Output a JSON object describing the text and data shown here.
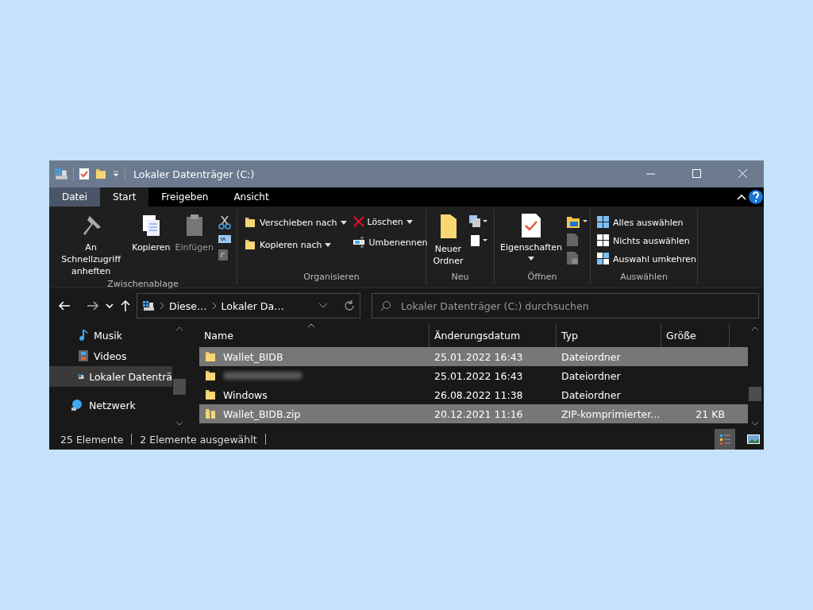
{
  "window": {
    "title": "Lokaler Datenträger (C:)"
  },
  "tabs": [
    {
      "label": "Datei",
      "selected": false,
      "kind": "file"
    },
    {
      "label": "Start",
      "selected": true,
      "kind": "tab"
    },
    {
      "label": "Freigeben",
      "selected": false,
      "kind": "tab"
    },
    {
      "label": "Ansicht",
      "selected": false,
      "kind": "tab"
    }
  ],
  "ribbon": {
    "clipboard": {
      "title": "Zwischenablage",
      "pin": "An Schnellzugriff anheften",
      "copy": "Kopieren",
      "paste": {
        "label": "Einfügen",
        "disabled": true
      }
    },
    "organize": {
      "title": "Organisieren",
      "move_to": "Verschieben nach",
      "copy_to": "Kopieren nach",
      "delete": "Löschen",
      "rename": "Umbenennen"
    },
    "new": {
      "title": "Neu",
      "new_folder": "Neuer Ordner"
    },
    "open": {
      "title": "Öffnen",
      "properties": "Eigenschaften"
    },
    "select": {
      "title": "Auswählen",
      "items": [
        "Alles auswählen",
        "Nichts auswählen",
        "Auswahl umkehren"
      ]
    }
  },
  "address": {
    "crumbs": [
      "Diese…",
      "Lokaler Da…"
    ]
  },
  "search": {
    "placeholder": "Lokaler Datenträger (C:) durchsuchen"
  },
  "sidebar": {
    "items": [
      {
        "label": "Musik",
        "kind": "music",
        "selected": false
      },
      {
        "label": "Videos",
        "kind": "video",
        "selected": false
      },
      {
        "label": "Lokaler Datenträ",
        "kind": "drive",
        "selected": true
      },
      {
        "label": "Netzwerk",
        "kind": "network",
        "selected": false
      }
    ]
  },
  "table": {
    "columns": [
      "Name",
      "Änderungsdatum",
      "Typ",
      "Größe"
    ],
    "rows": [
      {
        "kind": "folder",
        "name": "Wallet_BIDB",
        "date": "25.01.2022 16:43",
        "type": "Dateiordner",
        "selected": true
      },
      {
        "kind": "folder",
        "date": "25.01.2022 16:43",
        "type": "Dateiordner",
        "selected": false
      },
      {
        "kind": "folder",
        "name": "Windows",
        "date": "26.08.2022 11:38",
        "type": "Dateiordner",
        "selected": false
      },
      {
        "kind": "zip",
        "name": "Wallet_BIDB.zip",
        "date": "20.12.2021 11:16",
        "type": "ZIP-komprimierter...",
        "size": "21 KB",
        "selected": true
      }
    ]
  },
  "status_bar": {
    "count": "25 Elemente",
    "selection": "2 Elemente ausgewählt",
    "views": [
      {
        "kind": "details",
        "selected": true
      },
      {
        "kind": "tiles",
        "selected": false
      }
    ]
  }
}
